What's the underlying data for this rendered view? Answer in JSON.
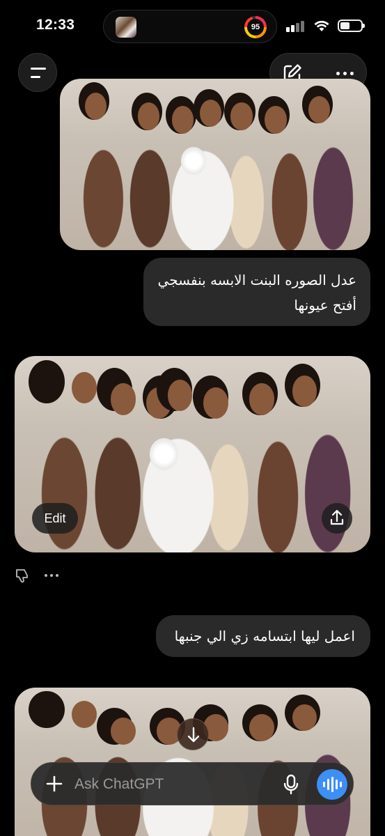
{
  "status_bar": {
    "time": "12:33",
    "activity_ring_value": "95",
    "icons": [
      "signal-icon",
      "wifi-icon",
      "battery-icon"
    ]
  },
  "nav": {
    "menu_icon": "hamburger-icon",
    "new_chat_icon": "edit-icon",
    "more_icon": "more-horizontal-icon"
  },
  "conversation": {
    "messages": [
      {
        "role": "user",
        "type": "image",
        "alt": ""
      },
      {
        "role": "user",
        "type": "text",
        "lines": [
          "عدل الصوره البنت الابسه بنفسجي",
          "أفتح عيونها"
        ]
      },
      {
        "role": "assistant",
        "type": "image",
        "edit_label": "Edit",
        "share_icon": "share-icon"
      },
      {
        "role": "assistant",
        "type": "feedback",
        "icons": [
          "thumbs-down-icon",
          "more-horizontal-icon"
        ]
      },
      {
        "role": "user",
        "type": "text",
        "lines": [
          "اعمل ليها ابتسامه زي الي جنبها"
        ]
      },
      {
        "role": "assistant",
        "type": "image"
      }
    ]
  },
  "composer": {
    "placeholder": "Ask ChatGPT",
    "plus_icon": "plus-icon",
    "mic_icon": "microphone-icon",
    "voice_icon": "voice-mode-icon"
  },
  "scroll_down_icon": "arrow-down-icon",
  "colors": {
    "background": "#000000",
    "bubble": "#2a2a2a",
    "voice_button": "#3d8ff5"
  }
}
